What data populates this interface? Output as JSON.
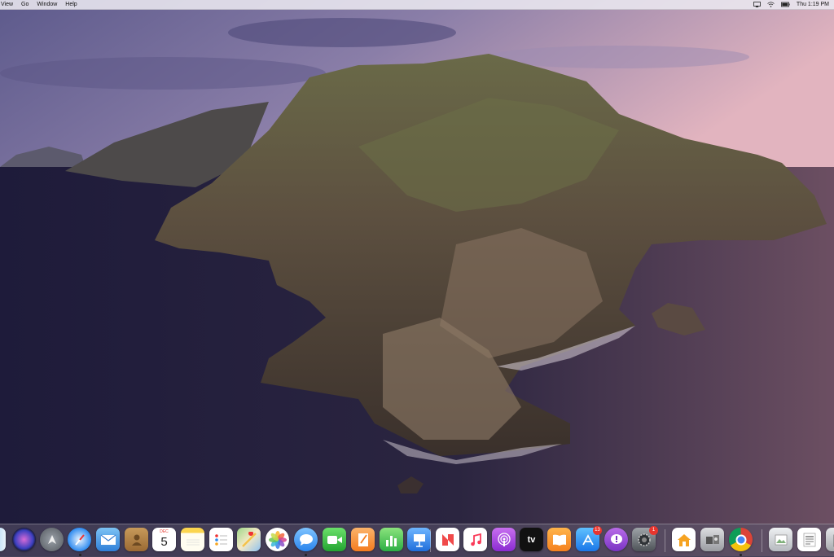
{
  "menubar": {
    "items": [
      "View",
      "Go",
      "Window",
      "Help"
    ],
    "status_icons": [
      "airplay-icon",
      "wifi-icon",
      "battery-icon",
      "search-icon"
    ],
    "clock": "Thu 1:19 PM"
  },
  "desktop": {
    "wallpaper": "macOS Catalina island",
    "colors": {
      "sky_top": "#6f6a99",
      "sky_pink": "#d4a5b8",
      "water": "#221f3c",
      "rock": "#6b5a4b"
    }
  },
  "dock": {
    "items": [
      {
        "name": "finder-icon",
        "label": "Finder"
      },
      {
        "name": "siri-icon",
        "label": "Siri"
      },
      {
        "name": "launchpad-icon",
        "label": "Launchpad"
      },
      {
        "name": "safari-icon",
        "label": "Safari"
      },
      {
        "name": "mail-icon",
        "label": "Mail"
      },
      {
        "name": "contacts-icon",
        "label": "Contacts"
      },
      {
        "name": "calendar-icon",
        "label": "Calendar",
        "month": "DEC",
        "day": "5"
      },
      {
        "name": "notes-icon",
        "label": "Notes"
      },
      {
        "name": "reminders-icon",
        "label": "Reminders"
      },
      {
        "name": "maps-icon",
        "label": "Maps"
      },
      {
        "name": "photos-icon",
        "label": "Photos"
      },
      {
        "name": "messages-icon",
        "label": "Messages"
      },
      {
        "name": "facetime-icon",
        "label": "FaceTime"
      },
      {
        "name": "pages-icon",
        "label": "Pages"
      },
      {
        "name": "numbers-icon",
        "label": "Numbers"
      },
      {
        "name": "keynote-icon",
        "label": "Keynote"
      },
      {
        "name": "news-icon",
        "label": "News"
      },
      {
        "name": "music-icon",
        "label": "Music"
      },
      {
        "name": "podcasts-icon",
        "label": "Podcasts"
      },
      {
        "name": "tv-icon",
        "label": "TV",
        "text": "tv"
      },
      {
        "name": "books-icon",
        "label": "Books"
      },
      {
        "name": "app-store-icon",
        "label": "App Store",
        "badge": "13"
      },
      {
        "name": "feedback-icon",
        "label": "Feedback Assistant"
      },
      {
        "name": "system-preferences-icon",
        "label": "System Preferences",
        "badge": "1"
      },
      {
        "name": "home-icon",
        "label": "Home"
      },
      {
        "name": "migration-icon",
        "label": "Migration Assistant"
      },
      {
        "name": "chrome-icon",
        "label": "Chrome"
      },
      {
        "name": "preview-icon",
        "label": "Preview"
      },
      {
        "name": "document-icon",
        "label": "Document"
      },
      {
        "name": "trash-icon",
        "label": "Trash"
      }
    ]
  }
}
